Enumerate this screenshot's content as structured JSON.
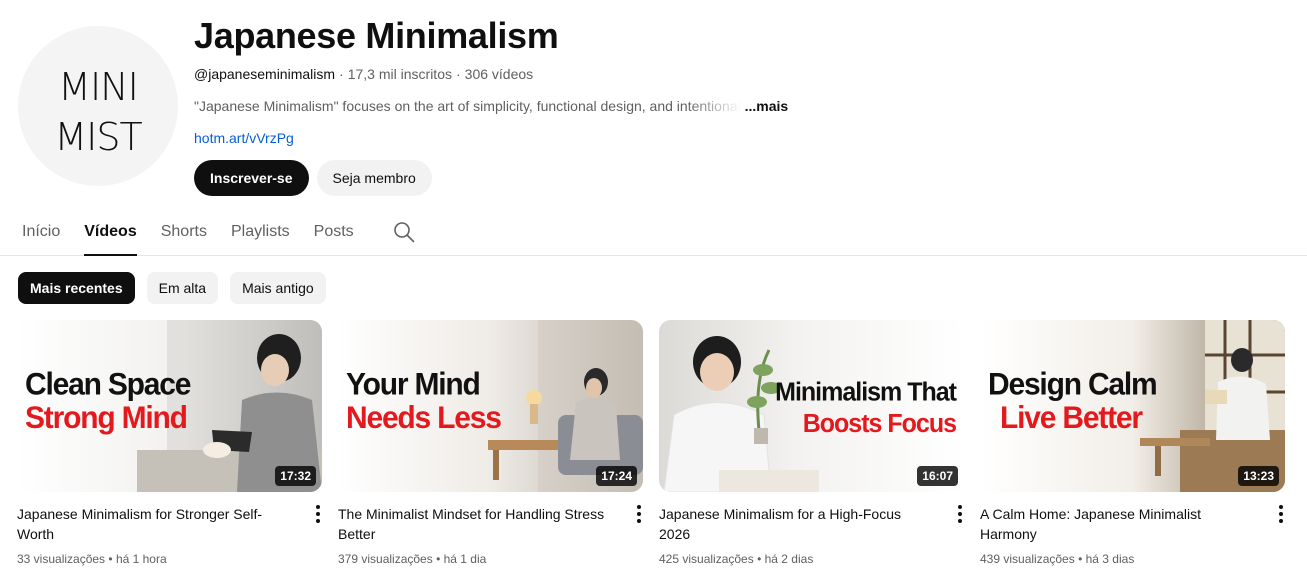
{
  "channel": {
    "avatar_text_line1": "MINI",
    "avatar_text_line2": "MIST",
    "title": "Japanese Minimalism",
    "handle": "@japaneseminimalism",
    "subscribers": "17,3 mil inscritos",
    "video_count": "306 vídeos",
    "description": "\"Japanese Minimalism\" focuses on the art of simplicity, functional design, and intentional",
    "more_label": "...mais",
    "link": "hotm.art/vVrzPg",
    "subscribe_label": "Inscrever-se",
    "join_label": "Seja membro"
  },
  "tabs": [
    {
      "label": "Início"
    },
    {
      "label": "Vídeos",
      "active": true
    },
    {
      "label": "Shorts"
    },
    {
      "label": "Playlists"
    },
    {
      "label": "Posts"
    }
  ],
  "chips": [
    {
      "label": "Mais recentes",
      "active": true
    },
    {
      "label": "Em alta"
    },
    {
      "label": "Mais antigo"
    }
  ],
  "videos": [
    {
      "thumb_line1": "Clean Space",
      "thumb_line2": "Strong Mind",
      "duration": "17:32",
      "title": "Japanese Minimalism for Stronger Self-Worth",
      "views": "33 visualizações",
      "age": "há 1 hora"
    },
    {
      "thumb_line1": "Your Mind",
      "thumb_line2": "Needs Less",
      "duration": "17:24",
      "title": "The Minimalist Mindset for Handling Stress Better",
      "views": "379 visualizações",
      "age": "há 1 dia"
    },
    {
      "thumb_line1": "Minimalism That",
      "thumb_line2": "Boosts Focus",
      "duration": "16:07",
      "title": "Japanese Minimalism for a High-Focus 2026",
      "views": "425 visualizações",
      "age": "há 2 dias"
    },
    {
      "thumb_line1": "Design Calm",
      "thumb_line2": "Live Better",
      "duration": "13:23",
      "title": "A Calm Home: Japanese Minimalist Harmony",
      "views": "439 visualizações",
      "age": "há 3 dias"
    }
  ],
  "colors": {
    "accent_red": "#e3191e",
    "link_blue": "#065fd4",
    "text_secondary": "#606060"
  },
  "icons": {
    "search": "search-icon",
    "more": "more-vert-icon"
  }
}
